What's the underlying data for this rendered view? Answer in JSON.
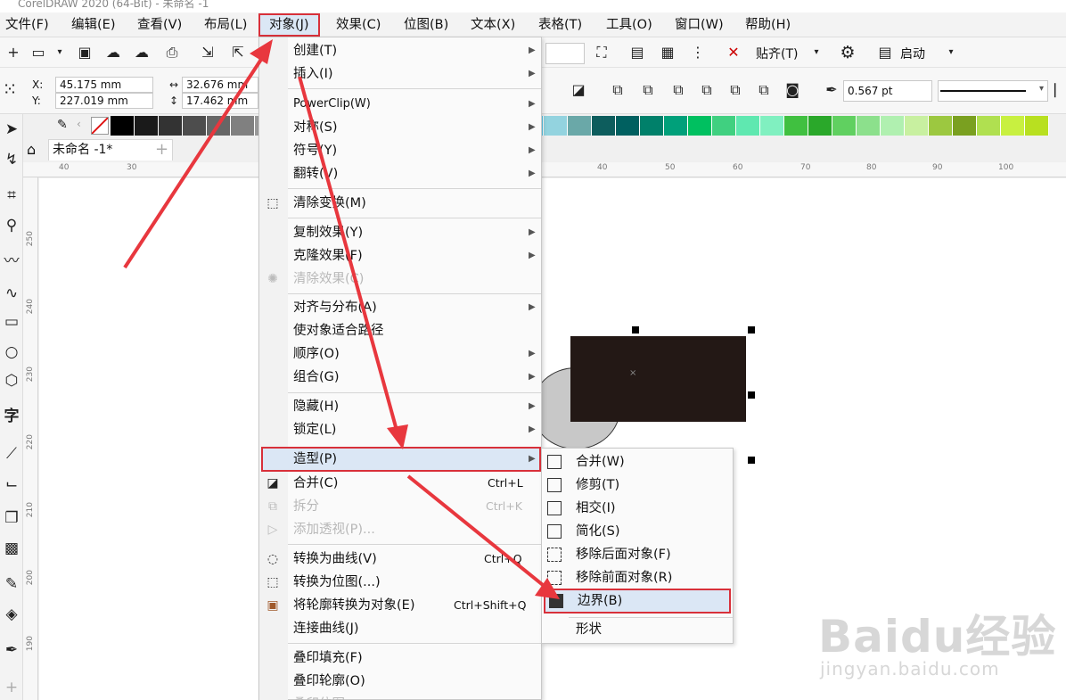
{
  "window": {
    "title": "CorelDRAW 2020 (64-Bit) - 未命名 -1"
  },
  "menubar": {
    "items": [
      {
        "label": "文件(F)"
      },
      {
        "label": "编辑(E)"
      },
      {
        "label": "查看(V)"
      },
      {
        "label": "布局(L)"
      },
      {
        "label": "对象(J)"
      },
      {
        "label": "效果(C)"
      },
      {
        "label": "位图(B)"
      },
      {
        "label": "文本(X)"
      },
      {
        "label": "表格(T)"
      },
      {
        "label": "工具(O)"
      },
      {
        "label": "窗口(W)"
      },
      {
        "label": "帮助(H)"
      }
    ]
  },
  "toolbar": {
    "snap_label": "贴齐(T)",
    "launch_label": "启动"
  },
  "property_bar": {
    "x_label": "X:",
    "y_label": "Y:",
    "x_value": "45.175 mm",
    "y_value": "227.019 mm",
    "w_value": "32.676 mm",
    "h_value": "17.462 mm",
    "outline_width": "0.567 pt"
  },
  "palette": {
    "colors": [
      "#000000",
      "#1a1a1a",
      "#333333",
      "#4d4d4d",
      "#666666",
      "#808080",
      "#999999",
      "#b3b3b3",
      "#cccccc",
      "#e6e6e6",
      "#5b5bff",
      "#3a3adf",
      "#0d1d8f",
      "#0033a0",
      "#0a4fa0",
      "#3a78c0",
      "#00a0e0",
      "#5bc8e8",
      "#93d3df",
      "#6aa8a8",
      "#0d5d5d",
      "#006060",
      "#00806a",
      "#00a07a",
      "#00c060",
      "#40d080",
      "#5fe8b0",
      "#80f0c0",
      "#40c040",
      "#2aa82a",
      "#60d060",
      "#8ce08c",
      "#b0f0b0",
      "#c8f0a0",
      "#9cc840",
      "#7aa020",
      "#b0e050",
      "#c8f040",
      "#b8e020"
    ]
  },
  "document": {
    "tab_label": "未命名 -1*"
  },
  "rulers": {
    "h": [
      "40",
      "30",
      "40",
      "50",
      "60",
      "70",
      "80",
      "90",
      "100"
    ],
    "v": [
      "250",
      "240",
      "230",
      "220",
      "210",
      "200",
      "190"
    ]
  },
  "object_menu": {
    "items": [
      {
        "label": "创建(T)",
        "submenu": true
      },
      {
        "label": "插入(I)",
        "submenu": true
      },
      {
        "label": "PowerClip(W)",
        "submenu": true
      },
      {
        "label": "对称(S)",
        "submenu": true
      },
      {
        "label": "符号(Y)",
        "submenu": true
      },
      {
        "label": "翻转(V)",
        "submenu": true
      },
      {
        "label": "清除变换(M)"
      },
      {
        "label": "复制效果(Y)",
        "submenu": true
      },
      {
        "label": "克隆效果(F)",
        "submenu": true
      },
      {
        "label": "清除效果(C)",
        "disabled": true
      },
      {
        "label": "对齐与分布(A)",
        "submenu": true
      },
      {
        "label": "使对象适合路径"
      },
      {
        "label": "顺序(O)",
        "submenu": true
      },
      {
        "label": "组合(G)",
        "submenu": true
      },
      {
        "label": "隐藏(H)",
        "submenu": true
      },
      {
        "label": "锁定(L)",
        "submenu": true
      },
      {
        "label": "造型(P)",
        "submenu": true,
        "highlighted": true
      },
      {
        "label": "合并(C)",
        "shortcut": "Ctrl+L"
      },
      {
        "label": "拆分",
        "shortcut": "Ctrl+K",
        "disabled": true
      },
      {
        "label": "添加透视(P)...",
        "disabled": true
      },
      {
        "label": "转换为曲线(V)",
        "shortcut": "Ctrl+Q"
      },
      {
        "label": "转换为位图(...)"
      },
      {
        "label": "将轮廓转换为对象(E)",
        "shortcut": "Ctrl+Shift+Q"
      },
      {
        "label": "连接曲线(J)"
      },
      {
        "label": "叠印填充(F)"
      },
      {
        "label": "叠印轮廓(O)"
      },
      {
        "label": "叠印位图"
      }
    ]
  },
  "shaping_submenu": {
    "items": [
      {
        "label": "合并(W)"
      },
      {
        "label": "修剪(T)"
      },
      {
        "label": "相交(I)"
      },
      {
        "label": "简化(S)"
      },
      {
        "label": "移除后面对象(F)"
      },
      {
        "label": "移除前面对象(R)"
      },
      {
        "label": "边界(B)",
        "highlighted": true
      },
      {
        "label": "形状"
      }
    ]
  },
  "watermark": {
    "brand": "Baidu经验",
    "url": "jingyan.baidu.com"
  },
  "colors": {
    "highlight_border": "#d8303a",
    "highlight_fill": "#dbe7f5",
    "arrow": "#e8373e",
    "rect_fill": "#231815",
    "ellipse_fill": "#c8c8c8"
  }
}
